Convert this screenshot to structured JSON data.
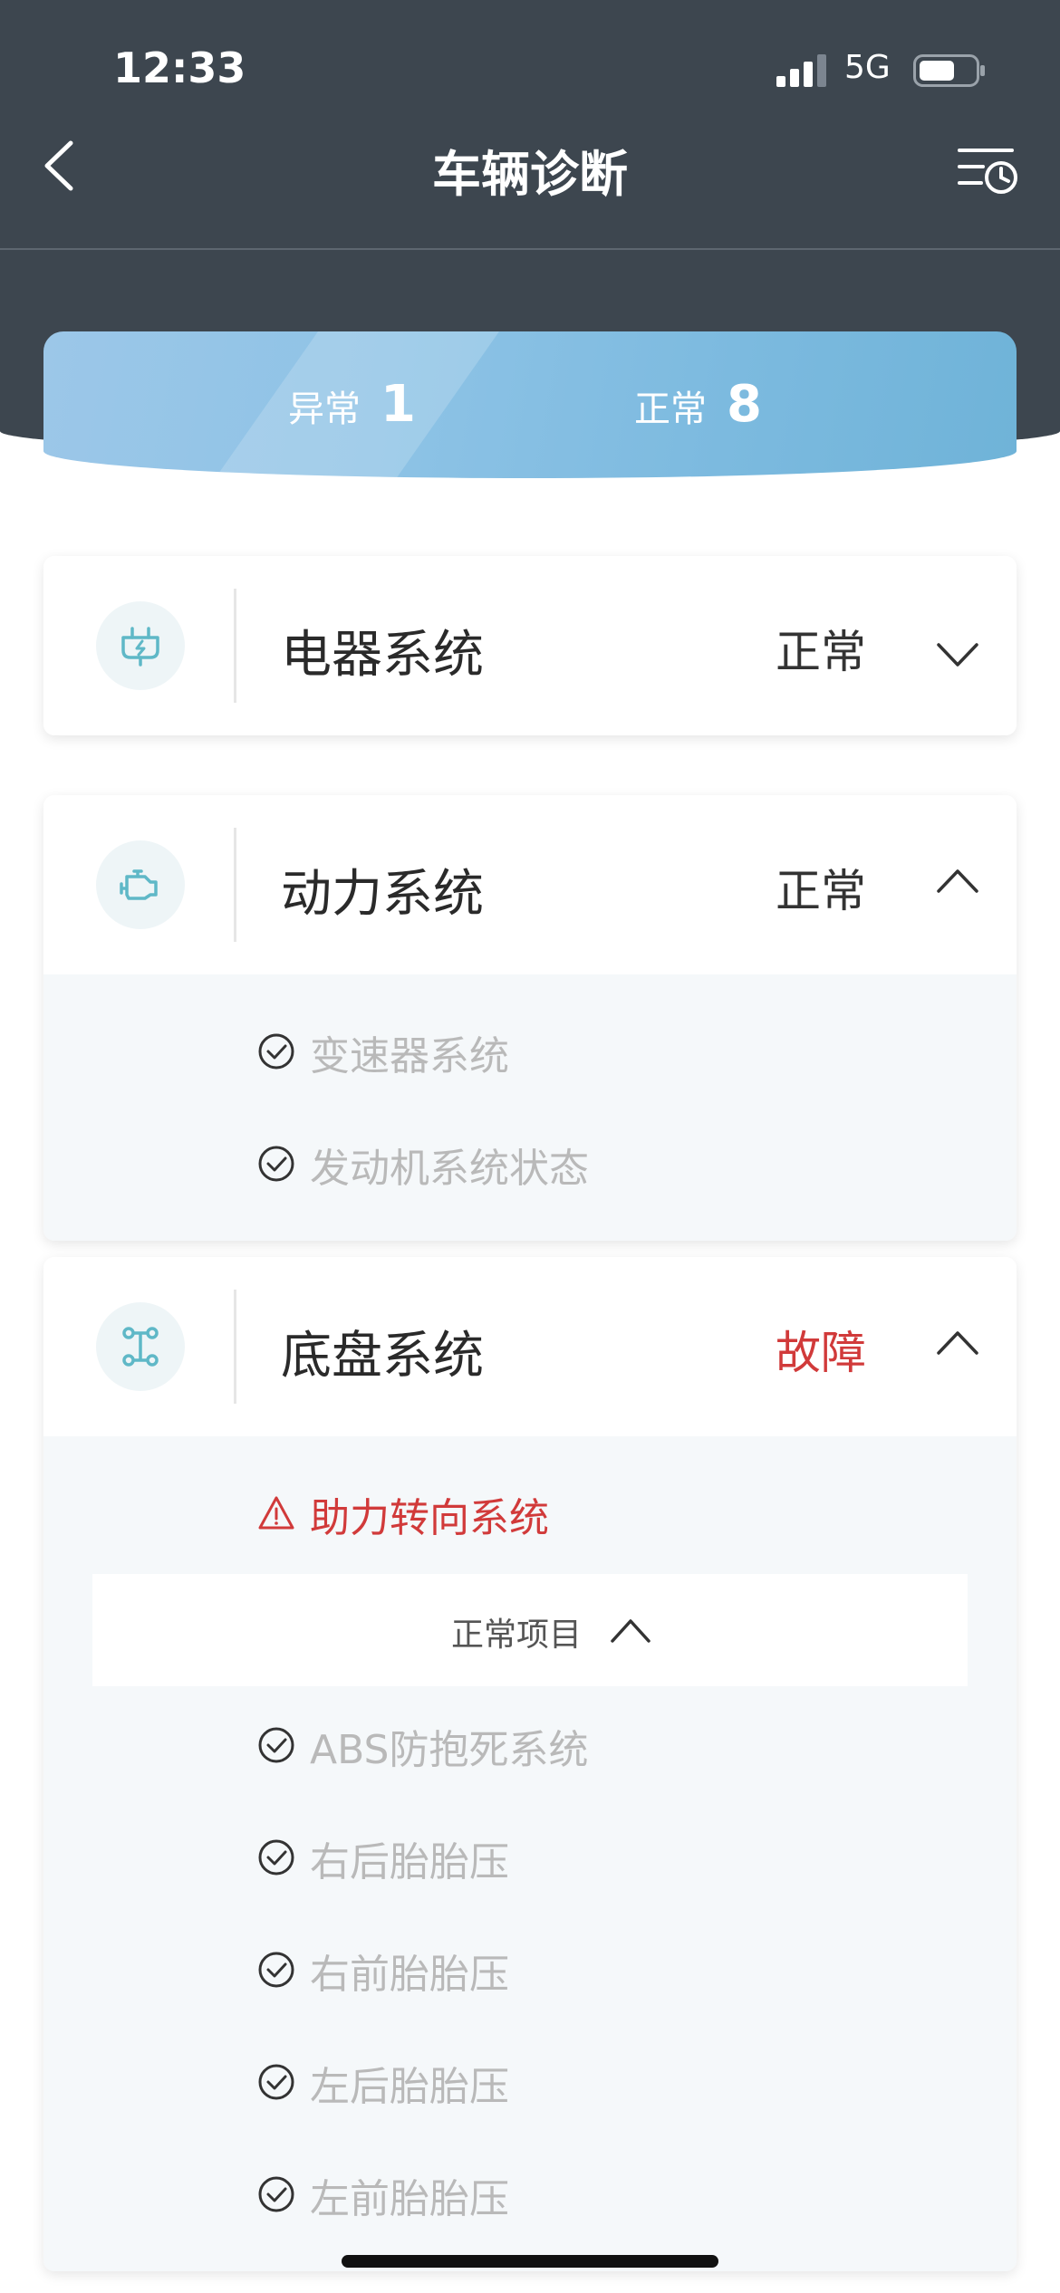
{
  "status_bar": {
    "time": "12:33",
    "network": "5G"
  },
  "header": {
    "title": "车辆诊断"
  },
  "summary": {
    "abnormal_label": "异常",
    "abnormal_count": "1",
    "normal_label": "正常",
    "normal_count": "8"
  },
  "systems": [
    {
      "name": "电器系统",
      "status": "正常",
      "icon": "plug-icon",
      "expanded": false
    },
    {
      "name": "动力系统",
      "status": "正常",
      "icon": "engine-icon",
      "expanded": true,
      "items": [
        "变速器系统",
        "发动机系统状态"
      ]
    },
    {
      "name": "底盘系统",
      "status": "故障",
      "icon": "chassis-icon",
      "expanded": true,
      "fault_items": [
        "助力转向系统"
      ],
      "normal_group_label": "正常项目",
      "items": [
        "ABS防抱死系统",
        "右后胎胎压",
        "右前胎胎压",
        "左后胎胎压",
        "左前胎胎压"
      ]
    }
  ],
  "colors": {
    "header_bg": "#3d464f",
    "accent": "#7cbadf",
    "fault": "#d13a3a",
    "muted_text": "#b9b9b9"
  }
}
